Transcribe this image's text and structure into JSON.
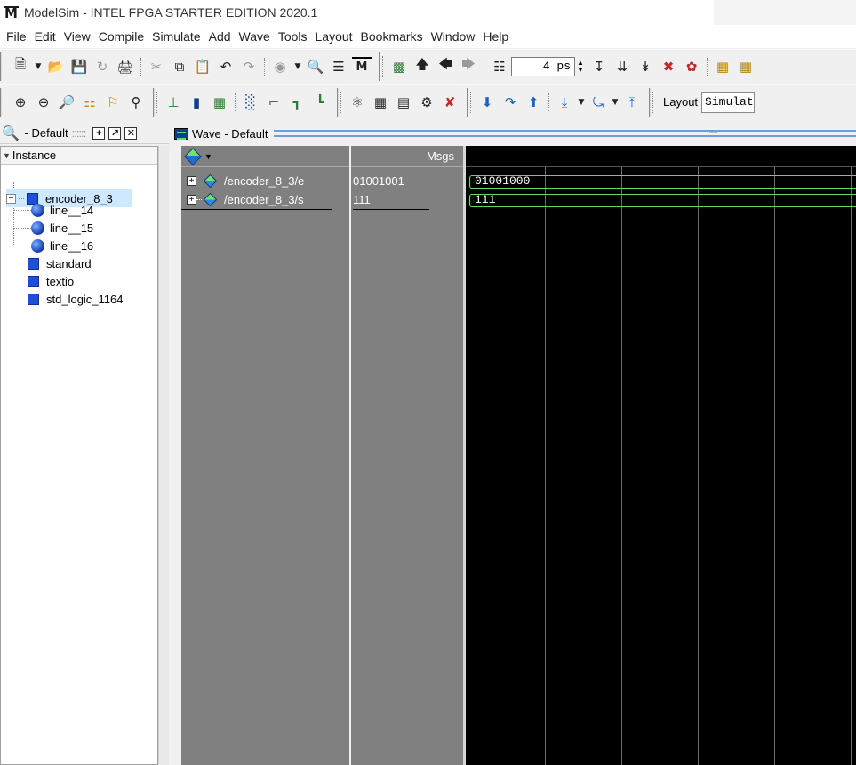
{
  "window": {
    "app_logo": "M",
    "title": "ModelSim - INTEL FPGA STARTER EDITION 2020.1"
  },
  "menu": [
    "File",
    "Edit",
    "View",
    "Compile",
    "Simulate",
    "Add",
    "Wave",
    "Tools",
    "Layout",
    "Bookmarks",
    "Window",
    "Help"
  ],
  "toolbar": {
    "time_step_value": "4 ps",
    "layout_label": "Layout",
    "layout_value": "Simulate"
  },
  "instance_panel": {
    "header_title": " - Default",
    "column_header": "Instance",
    "tree": [
      {
        "label": "encoder_8_3",
        "level": 0,
        "kind": "instance",
        "expanded": true,
        "selected": true
      },
      {
        "label": "line__14",
        "level": 1,
        "kind": "process"
      },
      {
        "label": "line__15",
        "level": 1,
        "kind": "process"
      },
      {
        "label": "line__16",
        "level": 1,
        "kind": "process"
      },
      {
        "label": "standard",
        "level": 0,
        "kind": "package"
      },
      {
        "label": "textio",
        "level": 0,
        "kind": "package"
      },
      {
        "label": "std_logic_1164",
        "level": 0,
        "kind": "package"
      }
    ]
  },
  "wave_panel": {
    "title": "Wave - Default",
    "msgs_header": "Msgs",
    "signals": [
      {
        "name": "/encoder_8_3/e",
        "msg_value": "01001001",
        "wave_value": "01001000"
      },
      {
        "name": "/encoder_8_3/s",
        "msg_value": "111",
        "wave_value": "111"
      }
    ],
    "colors": {
      "wave_background": "#000000",
      "bus_color": "#5fdc5f",
      "pane_gray": "#808080"
    }
  }
}
